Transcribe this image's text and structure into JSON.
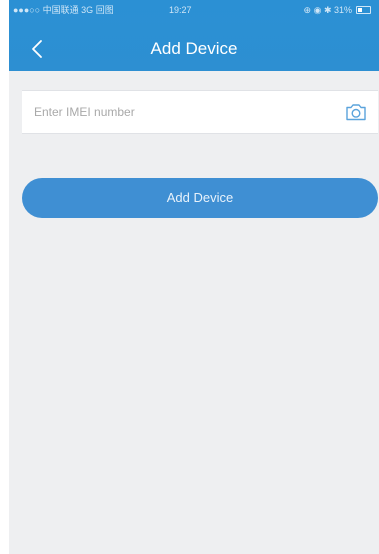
{
  "status_bar": {
    "carrier": "●●●○○ 中国联通  3G  回图",
    "time": "19:27",
    "icons": "⊕ ◉ ✱  31%"
  },
  "header": {
    "back_icon": "chevron-left-icon",
    "title": "Add Device"
  },
  "form": {
    "imei_value": "",
    "imei_placeholder": "Enter IMEI number",
    "camera_icon": "camera-icon",
    "submit_label": "Add Device"
  },
  "colors": {
    "header_bg": "#2d8fd2",
    "button_bg": "#3f8fd3",
    "page_bg": "#eeeff1"
  }
}
